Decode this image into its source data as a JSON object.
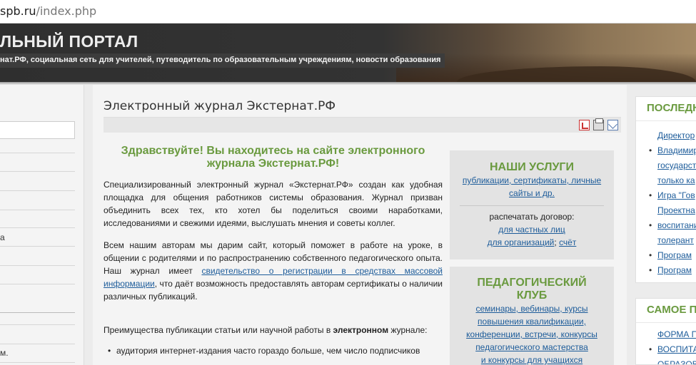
{
  "url": {
    "host": "spb.ru",
    "path": "/index.php"
  },
  "header": {
    "title": "ЛЬНЫЙ ПОРТАЛ",
    "tagline": "нат.РФ, социальная сеть для учителей, путеводитель по образовательным учреждениям, новости образования"
  },
  "left_nav": {
    "items": [
      "а",
      "м."
    ]
  },
  "main": {
    "page_title": "Электронный журнал Экстернат.РФ",
    "greeting": "Здравствуйте! Вы находитесь на сайте электронного журнала Экстернат.РФ!",
    "para1": "Специализированный электронный журнал «Экстернат.РФ» создан как удобная площадка для общения работников системы образования. Журнал призван объединить всех тех, кто хотел бы поделиться своими наработками, исследованиями и свежими идеями, выслушать мнения и советы коллег.",
    "para2_start": "Всем нашим авторам мы дарим сайт, который поможет в работе на уроке, в общении с родителями и по распространению собственного педагогического опыта. Наш журнал имеет ",
    "para2_link": "свидетельство о регистрации в средствах массовой информации",
    "para2_end": ", что даёт возможность предоставлять авторам сертификаты о наличии различных публикаций.",
    "para3_start": "Преимущества публикации статьи или научной работы в ",
    "para3_bold": "электронном",
    "para3_end": " журнале:",
    "bullet1": "аудитория интернет-издания часто гораздо больше, чем число подписчиков",
    "icons": [
      "pdf-icon",
      "print-icon",
      "email-icon"
    ]
  },
  "services": {
    "title": "НАШИ УСЛУГИ",
    "link": "публикации, сертификаты, личные сайты и др.",
    "print_label": "распечатать договор:",
    "link_private": "для частных лиц",
    "link_org": "для организаций",
    "sep": "; ",
    "link_invoice": "счёт"
  },
  "club": {
    "title": "ПЕДАГОГИЧЕСКИЙ КЛУБ",
    "links": [
      "семинары, вебинары, курсы",
      "повышения квалификации,",
      "конференции, встречи, конкурсы",
      "педагогического мастерства",
      "и конкурсы для учащихся"
    ]
  },
  "right_sidebar": {
    "latest_title": "ПОСЛЕДН",
    "latest": [
      "Директор",
      "Владимир",
      "государст",
      "только ка",
      "Игра \"Гов",
      "Проектна",
      "воспитани",
      "толерант",
      "Програм",
      "Програм"
    ],
    "top_title": "САМОЕ ПО",
    "top": [
      "ФОРМА П",
      "ВОСПИТА",
      "ОБРАЗОВ"
    ]
  }
}
